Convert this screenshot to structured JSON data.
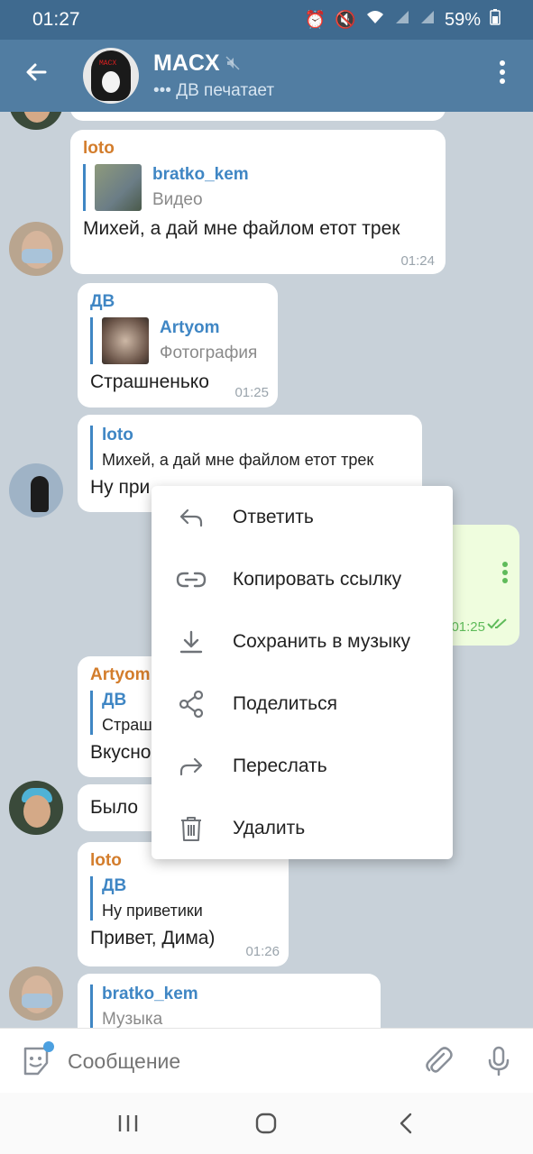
{
  "status_bar": {
    "time": "01:27",
    "battery": "59%",
    "icons": [
      "alarm-icon",
      "mute-icon",
      "wifi-icon",
      "signal-icon",
      "signal-icon",
      "battery-icon"
    ]
  },
  "header": {
    "title": "MACX",
    "status": "••• ДВ печатает",
    "avatar_text": "MACX",
    "colors": {
      "header": "#517da2",
      "status_bar": "#3f6a8f"
    }
  },
  "messages": [
    {
      "sender": "loto",
      "reply_title": "bratko_kem",
      "reply_sub": "Видео",
      "text": "Михей, а дай мне файлом етот трек",
      "time": "01:24"
    },
    {
      "sender": "ДВ",
      "reply_title": "Artyom",
      "reply_sub": "Фотография",
      "text": "Страшненько",
      "time": "01:25"
    },
    {
      "reply_title": "loto",
      "reply_sub": "Михей, а дай мне файлом етот трек",
      "text": "Ну при"
    },
    {
      "time": "01:25"
    },
    {
      "sender": "Artyom",
      "reply_title": "ДВ",
      "reply_sub": "Страш",
      "text": "Вкусно"
    },
    {
      "text": "Было"
    },
    {
      "sender": "loto",
      "reply_title": "ДВ",
      "reply_sub": "Ну приветики",
      "text": "Привет, Дима)",
      "time": "01:26"
    },
    {
      "reply_title": "bratko_kem",
      "reply_sub": "Музыка"
    }
  ],
  "context_menu": [
    {
      "label": "Ответить",
      "icon": "reply-icon"
    },
    {
      "label": "Копировать ссылку",
      "icon": "link-icon"
    },
    {
      "label": "Сохранить в музыку",
      "icon": "download-icon"
    },
    {
      "label": "Поделиться",
      "icon": "share-icon"
    },
    {
      "label": "Переслать",
      "icon": "forward-icon"
    },
    {
      "label": "Удалить",
      "icon": "trash-icon"
    }
  ],
  "composer": {
    "placeholder": "Сообщение"
  },
  "nav": [
    "recents-icon",
    "home-icon",
    "back-icon"
  ]
}
